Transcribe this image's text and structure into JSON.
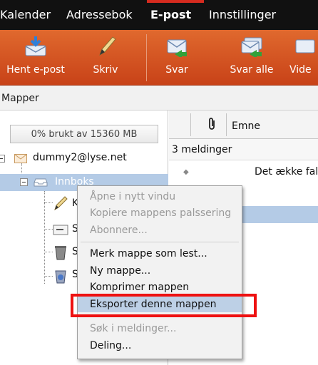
{
  "nav": {
    "items": [
      {
        "label": "Kalender",
        "active": false
      },
      {
        "label": "Adressebok",
        "active": false
      },
      {
        "label": "E-post",
        "active": true
      },
      {
        "label": "Innstillinger",
        "active": false
      }
    ]
  },
  "toolbar": {
    "buttons": [
      {
        "label": "Hent e-post",
        "icon": "download-mail-icon"
      },
      {
        "label": "Skriv",
        "icon": "pencil-icon"
      },
      {
        "label": "Svar",
        "icon": "reply-icon"
      },
      {
        "label": "Svar alle",
        "icon": "reply-all-icon"
      },
      {
        "label": "Vide",
        "icon": "forward-icon"
      }
    ]
  },
  "folders": {
    "header": "Mapper",
    "usage": "0% brukt av 15360 MB",
    "account": "dummy2@lyse.net",
    "inbox": "Innboks",
    "subfolder_letters": [
      "K",
      "S",
      "S",
      "S"
    ]
  },
  "messages": {
    "subject_header": "Emne",
    "count_label": "3 meldinger",
    "rows": [
      {
        "subject": "Det ække fal"
      }
    ]
  },
  "context_menu": {
    "group1": [
      {
        "label": "Åpne i nytt vindu",
        "enabled": false
      },
      {
        "label": "Kopiere mappens palssering",
        "enabled": false
      },
      {
        "label": "Abonnere...",
        "enabled": false
      }
    ],
    "group2": [
      {
        "label": "Merk mappe som lest...",
        "enabled": true
      },
      {
        "label": "Ny mappe...",
        "enabled": true
      },
      {
        "label": "Komprimer mappen",
        "enabled": true
      },
      {
        "label": "Eksporter denne mappen",
        "enabled": true,
        "highlighted": true
      }
    ],
    "group3": [
      {
        "label": "Søk i meldinger...",
        "enabled": false
      },
      {
        "label": "Deling...",
        "enabled": true
      }
    ]
  },
  "colors": {
    "accent": "#d62b1f",
    "toolbar": "#c84218",
    "selection": "#b4cbe6",
    "highlight": "#ee1111"
  }
}
